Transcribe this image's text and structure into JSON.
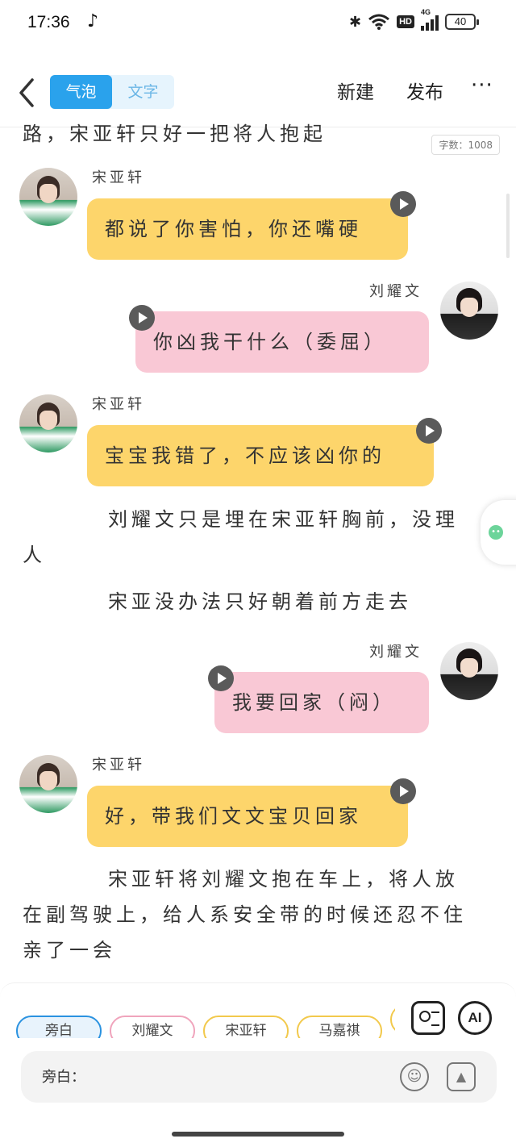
{
  "status_bar": {
    "time": "17:36",
    "network": "4G",
    "hd": "HD",
    "battery": "40",
    "icons": [
      "music-note-icon",
      "bluetooth-icon",
      "wifi-icon",
      "signal-icon",
      "battery-icon"
    ]
  },
  "header": {
    "tabs": [
      {
        "label": "气泡",
        "active": true
      },
      {
        "label": "文字",
        "active": false
      }
    ],
    "new_label": "新建",
    "publish_label": "发布",
    "more_label": "···"
  },
  "editor": {
    "cutoff_text": "路，宋亚轩只好一把将人抱起",
    "word_count": "字数：1008",
    "messages": [
      {
        "type": "bubble",
        "speaker": "宋亚轩",
        "side": "left",
        "text": "都说了你害怕，你还嘴硬",
        "color": "#fdd56b"
      },
      {
        "type": "bubble",
        "speaker": "刘耀文",
        "side": "right",
        "text": "你凶我干什么（委屈）",
        "color": "#f9c8d5"
      },
      {
        "type": "bubble",
        "speaker": "宋亚轩",
        "side": "left",
        "text": "宝宝我错了，不应该凶你的",
        "color": "#fdd56b"
      },
      {
        "type": "narration",
        "text": "刘耀文只是埋在宋亚轩胸前，没理人"
      },
      {
        "type": "narration",
        "text": "宋亚没办法只好朝着前方走去"
      },
      {
        "type": "bubble",
        "speaker": "刘耀文",
        "side": "right",
        "text": "我要回家（闷）",
        "color": "#f9c8d5"
      },
      {
        "type": "bubble",
        "speaker": "宋亚轩",
        "side": "left",
        "text": "好，带我们文文宝贝回家",
        "color": "#fdd56b"
      },
      {
        "type": "narration",
        "text": "宋亚轩将刘耀文抱在车上，将人放在副驾驶上，给人系安全带的时候还忍不住亲了一会"
      }
    ]
  },
  "bottom": {
    "roles": [
      "旁白",
      "刘耀文",
      "宋亚轩",
      "马嘉祺",
      ""
    ],
    "ai_label": "AI",
    "input_label": "旁白：",
    "input_value": "",
    "accent_color": "#2aa2ec"
  }
}
